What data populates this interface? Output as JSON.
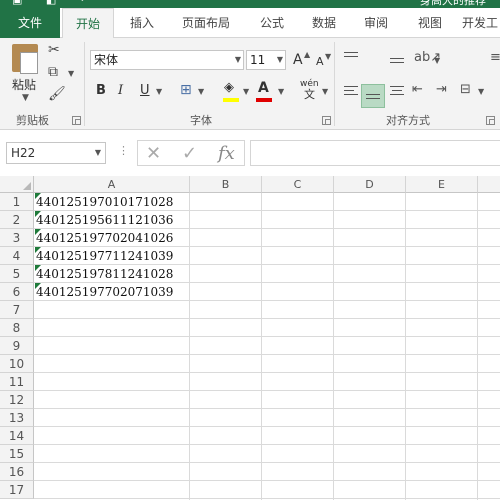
{
  "window": {
    "title": "身高大的推荐"
  },
  "quick_access": {
    "icons": [
      "excel-logo-icon",
      "save-icon",
      "undo-icon"
    ]
  },
  "tabs": {
    "file": "文件",
    "home": "开始",
    "insert": "插入",
    "layout": "页面布局",
    "formulas": "公式",
    "data": "数据",
    "review": "审阅",
    "view": "视图",
    "developer": "开发工"
  },
  "ribbon": {
    "clipboard": {
      "paste": "粘贴",
      "group": "剪贴板"
    },
    "font": {
      "name": "宋体",
      "size": "11",
      "bold": "B",
      "italic": "I",
      "underline": "U",
      "grow": "A",
      "shrink": "A",
      "phonetic": "wén",
      "phonetic_sub": "文",
      "group": "字体"
    },
    "alignment": {
      "group": "对齐方式"
    }
  },
  "formula_bar": {
    "cell_ref": "H22",
    "cancel": "✕",
    "enter": "✓",
    "fx": "fx",
    "value": ""
  },
  "sheet": {
    "columns": [
      "A",
      "B",
      "C",
      "D",
      "E"
    ],
    "rows": [
      "1",
      "2",
      "3",
      "4",
      "5",
      "6",
      "7",
      "8",
      "9",
      "10",
      "11",
      "12",
      "13",
      "14",
      "15",
      "16",
      "17"
    ],
    "cells_A": [
      "440125197010171028",
      "440125195611121036",
      "440125197702041026",
      "440125197711241039",
      "440125197811241028",
      "440125197702071039"
    ]
  },
  "colors": {
    "brand": "#217346",
    "ribbon_bg": "#f3f3f3",
    "error_indicator": "#1e7a3a",
    "font_color_bar": "#e00000",
    "fill_color_bar": "#ffff00"
  }
}
